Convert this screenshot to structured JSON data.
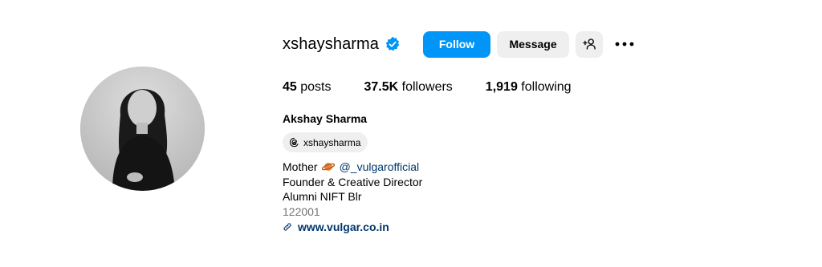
{
  "profile": {
    "username": "xshaysharma",
    "full_name": "Akshay Sharma",
    "verified_icon": "verified-badge-icon"
  },
  "actions": {
    "follow_label": "Follow",
    "message_label": "Message",
    "suggest_icon": "add-person-icon",
    "more_icon": "more-options-icon"
  },
  "stats": {
    "posts_count": "45",
    "posts_label": "posts",
    "followers_count": "37.5K",
    "followers_label": "followers",
    "following_count": "1,919",
    "following_label": "following"
  },
  "threads": {
    "handle": "xshaysharma",
    "icon": "threads-icon"
  },
  "bio": {
    "line1_text": "Mother",
    "line1_emoji": "planet-emoji",
    "line1_mention": "@_vulgarofficial",
    "line2": "Founder & Creative Director",
    "line3": "Alumni NIFT Blr",
    "line4": "122001",
    "website": "www.vulgar.co.in",
    "website_icon": "link-icon"
  },
  "colors": {
    "primary_button": "#0095f6",
    "secondary_button": "#efefef",
    "link": "#00376b",
    "muted": "#737373"
  }
}
